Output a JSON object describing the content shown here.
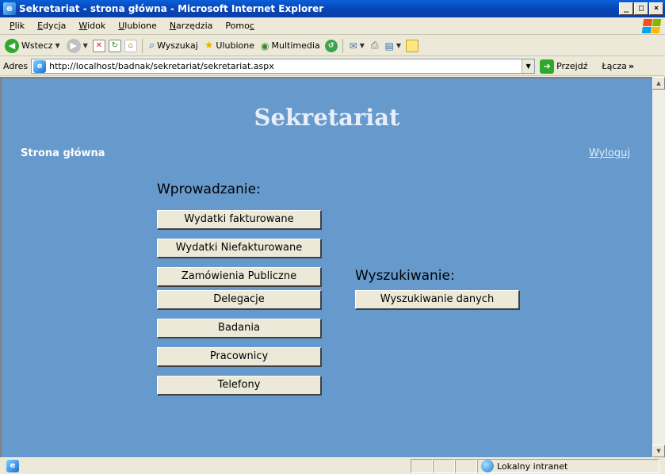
{
  "window": {
    "title": "Sekretariat - strona główna - Microsoft Internet Explorer",
    "minimize": "_",
    "maximize": "□",
    "close": "×"
  },
  "menu": {
    "items": [
      {
        "pre": "",
        "u": "P",
        "post": "lik"
      },
      {
        "pre": "",
        "u": "E",
        "post": "dycja"
      },
      {
        "pre": "",
        "u": "W",
        "post": "idok"
      },
      {
        "pre": "",
        "u": "U",
        "post": "lubione"
      },
      {
        "pre": "",
        "u": "N",
        "post": "arzędzia"
      },
      {
        "pre": "Pomo",
        "u": "c",
        "post": ""
      }
    ]
  },
  "toolbar": {
    "back_label": "Wstecz",
    "search_label": "Wyszukaj",
    "favorites_label": "Ulubione",
    "media_label": "Multimedia"
  },
  "address": {
    "label": "Adres",
    "url": "http://localhost/badnak/sekretariat/sekretariat.aspx",
    "go_label": "Przejdź",
    "links_label": "Łącza"
  },
  "page": {
    "title": "Sekretariat",
    "home_label": "Strona główna",
    "logout_label": "Wyloguj",
    "entry_heading": "Wprowadzanie:",
    "entry_buttons": [
      "Wydatki fakturowane",
      "Wydatki Niefakturowane",
      "Zamówienia Publiczne",
      "Delegacje",
      "Badania",
      "Pracownicy",
      "Telefony"
    ],
    "search_heading": "Wyszukiwanie:",
    "search_button": "Wyszukiwanie danych"
  },
  "status": {
    "zone": "Lokalny intranet"
  },
  "colors": {
    "page_background": "#6699cc",
    "title_color": "#e8eef8"
  }
}
